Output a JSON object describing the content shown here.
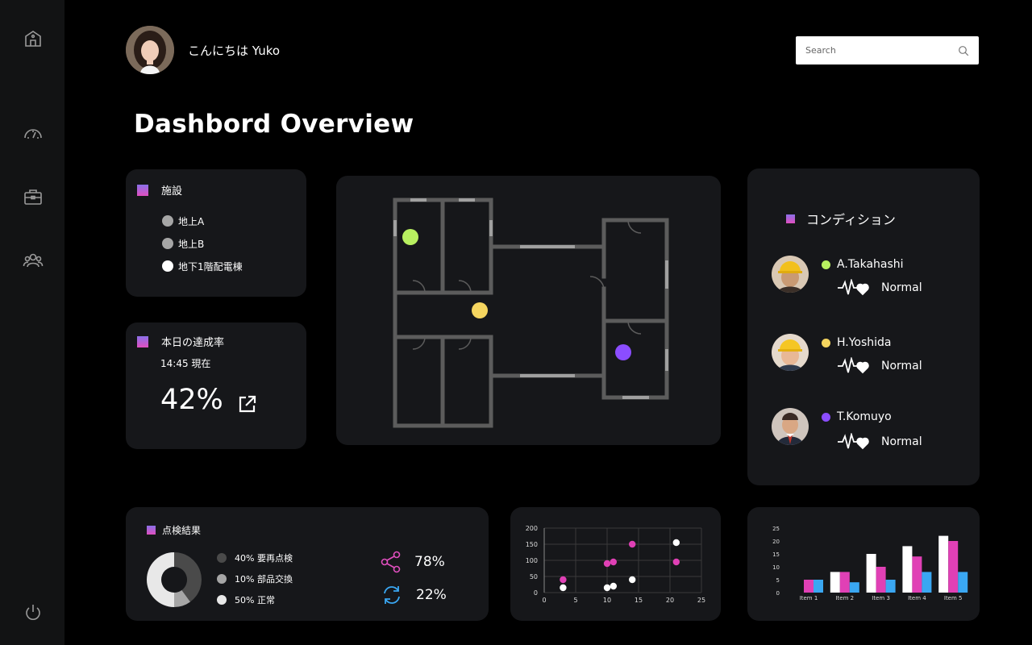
{
  "header": {
    "greeting": "こんにちは Yuko",
    "search_placeholder": "Search"
  },
  "page_title": "Dashbord Overview",
  "sidebar": {
    "items": [
      {
        "icon": "home-icon"
      },
      {
        "icon": "speedometer-icon"
      },
      {
        "icon": "briefcase-icon"
      },
      {
        "icon": "users-icon"
      },
      {
        "icon": "power-icon"
      }
    ]
  },
  "facility": {
    "title": "施設",
    "items": [
      {
        "label": "地上A",
        "color": "#a6a6a6"
      },
      {
        "label": "地上B",
        "color": "#a6a6a6"
      },
      {
        "label": "地下1階配電棟",
        "color": "#ffffff"
      }
    ]
  },
  "achievement": {
    "title": "本日の達成率",
    "time": "14:45 現在",
    "value": "42%"
  },
  "floorplan": {
    "markers": [
      {
        "color": "#b8f060"
      },
      {
        "color": "#f5d55f"
      },
      {
        "color": "#8b4dff"
      }
    ]
  },
  "condition": {
    "title": "コンディション",
    "workers": [
      {
        "name": "A.Takahashi",
        "color": "#b8f060",
        "status": "Normal"
      },
      {
        "name": "H.Yoshida",
        "color": "#f5d55f",
        "status": "Normal"
      },
      {
        "name": "T.Komuyo",
        "color": "#8b4dff",
        "status": "Normal"
      }
    ]
  },
  "inspection": {
    "title": "点検結果",
    "legend": [
      {
        "label": "40% 要再点検",
        "color": "#4a4a4a"
      },
      {
        "label": "10% 部品交換",
        "color": "#a6a6a6"
      },
      {
        "label": "50% 正常",
        "color": "#e8e8e8"
      }
    ],
    "stats": [
      {
        "icon": "share-icon",
        "value": "78%",
        "color": "#e04fbe"
      },
      {
        "icon": "refresh-icon",
        "value": "22%",
        "color": "#3aa7f2"
      }
    ]
  },
  "chart_data": [
    {
      "type": "pie",
      "slices": [
        {
          "label": "要再点検",
          "value": 40,
          "color": "#4a4a4a"
        },
        {
          "label": "部品交換",
          "value": 10,
          "color": "#a6a6a6"
        },
        {
          "label": "正常",
          "value": 50,
          "color": "#e8e8e8"
        }
      ]
    },
    {
      "type": "scatter",
      "xlim": [
        0,
        25
      ],
      "ylim": [
        0,
        200
      ],
      "xticks": [
        "0",
        "5",
        "10",
        "15",
        "20",
        "25"
      ],
      "yticks": [
        "0",
        "50",
        "100",
        "150",
        "200"
      ],
      "grid": true,
      "series": [
        {
          "color": "#e040b5",
          "points": [
            [
              3,
              40
            ],
            [
              10,
              90
            ],
            [
              11,
              95
            ],
            [
              14,
              150
            ],
            [
              21,
              95
            ]
          ]
        },
        {
          "color": "#ffffff",
          "points": [
            [
              3,
              15
            ],
            [
              10,
              15
            ],
            [
              11,
              20
            ],
            [
              14,
              40
            ],
            [
              21,
              155
            ]
          ]
        }
      ]
    },
    {
      "type": "bar",
      "categories": [
        "Item 1",
        "Item 2",
        "Item 3",
        "Item 4",
        "Item 5"
      ],
      "ylim": [
        0,
        25
      ],
      "yticks": [
        "0",
        "5",
        "10",
        "15",
        "20",
        "25"
      ],
      "series": [
        {
          "color": "#ffffff",
          "values": [
            0,
            8,
            15,
            18,
            22
          ]
        },
        {
          "color": "#e040b5",
          "values": [
            5,
            8,
            10,
            14,
            20
          ]
        },
        {
          "color": "#3aa7f2",
          "values": [
            5,
            4,
            5,
            8,
            8
          ]
        }
      ]
    }
  ]
}
